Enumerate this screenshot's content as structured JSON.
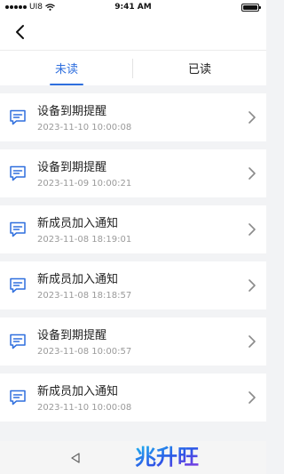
{
  "status_bar": {
    "carrier": "UI8",
    "time": "9:41 AM"
  },
  "tabs": [
    {
      "label": "未读",
      "active": true
    },
    {
      "label": "已读",
      "active": false
    }
  ],
  "messages": [
    {
      "title": "设备到期提醒",
      "time": "2023-11-10 10:00:08"
    },
    {
      "title": "设备到期提醒",
      "time": "2023-11-09 10:00:21"
    },
    {
      "title": "新成员加入通知",
      "time": "2023-11-08 18:19:01"
    },
    {
      "title": "新成员加入通知",
      "time": "2023-11-08 18:18:57"
    },
    {
      "title": "设备到期提醒",
      "time": "2023-11-08 10:00:57"
    },
    {
      "title": "新成员加入通知",
      "time": "2023-11-10 10:00:08"
    }
  ],
  "watermark": {
    "text": "兆升旺"
  },
  "colors": {
    "accent": "#2f6fde",
    "muted": "#9a9a9a"
  }
}
